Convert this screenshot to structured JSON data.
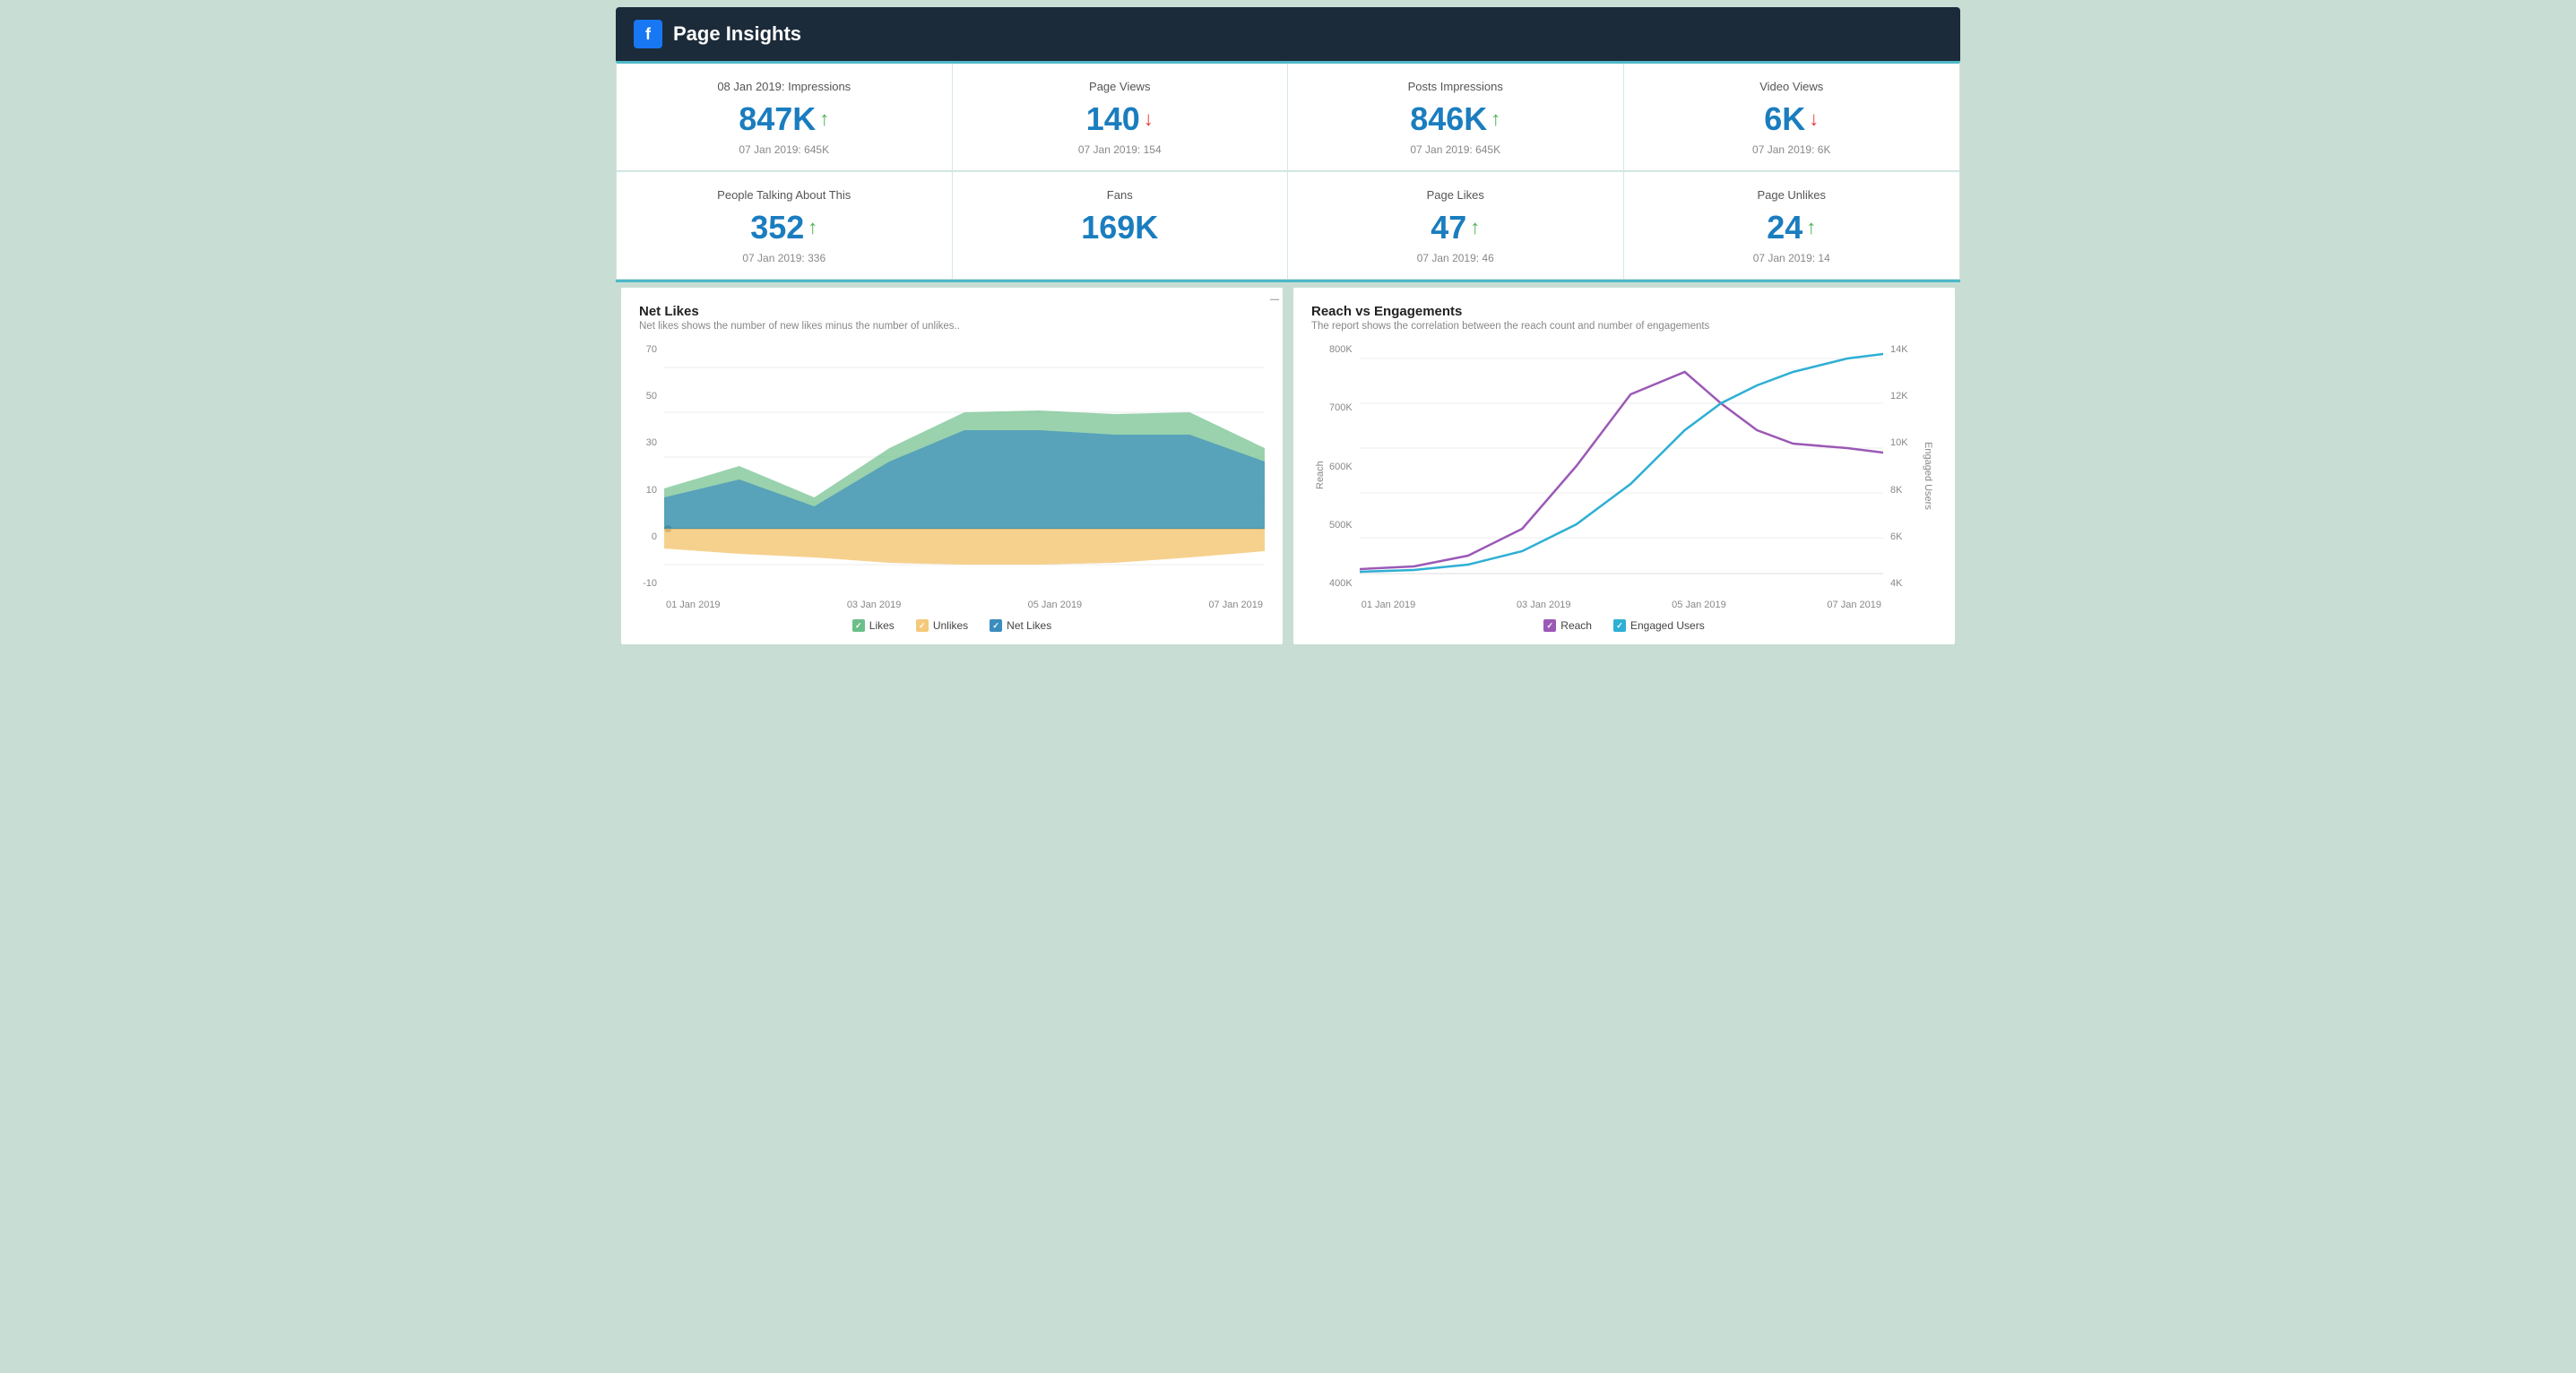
{
  "header": {
    "title": "Page Insights",
    "fb_label": "f"
  },
  "stats_row1": [
    {
      "label": "08 Jan 2019: Impressions",
      "value": "847K",
      "trend": "up",
      "prev": "07 Jan 2019: 645K"
    },
    {
      "label": "Page Views",
      "value": "140",
      "trend": "down",
      "prev": "07 Jan 2019: 154"
    },
    {
      "label": "Posts Impressions",
      "value": "846K",
      "trend": "up",
      "prev": "07 Jan 2019: 645K"
    },
    {
      "label": "Video Views",
      "value": "6K",
      "trend": "down",
      "prev": "07 Jan 2019: 6K"
    }
  ],
  "stats_row2": [
    {
      "label": "People Talking About This",
      "value": "352",
      "trend": "up",
      "prev": "07 Jan 2019: 336"
    },
    {
      "label": "Fans",
      "value": "169K",
      "trend": "none",
      "prev": ""
    },
    {
      "label": "Page Likes",
      "value": "47",
      "trend": "up",
      "prev": "07 Jan 2019: 46"
    },
    {
      "label": "Page Unlikes",
      "value": "24",
      "trend": "up",
      "prev": "07 Jan 2019: 14"
    }
  ],
  "chart_net_likes": {
    "title": "Net Likes",
    "subtitle": "Net likes shows the number of new likes minus the number of unlikes..",
    "y_axis": [
      "70",
      "50",
      "30",
      "10",
      "0",
      "-10"
    ],
    "x_axis": [
      "01 Jan 2019",
      "03 Jan 2019",
      "05 Jan 2019",
      "07 Jan 2019"
    ],
    "legend": [
      {
        "label": "Likes",
        "color": "#6dbf8a"
      },
      {
        "label": "Unlikes",
        "color": "#f5c97a"
      },
      {
        "label": "Net Likes",
        "color": "#3c8dbf"
      }
    ]
  },
  "chart_reach": {
    "title": "Reach vs Engagements",
    "subtitle": "The report shows the correlation between the reach count and number of engagements",
    "y_axis_left": [
      "800K",
      "700K",
      "600K",
      "500K",
      "400K"
    ],
    "y_axis_right": [
      "14K",
      "12K",
      "10K",
      "8K",
      "6K",
      "4K"
    ],
    "y_axis_left_title": "Reach",
    "y_axis_right_title": "Engaged Users",
    "x_axis": [
      "01 Jan 2019",
      "03 Jan 2019",
      "05 Jan 2019",
      "07 Jan 2019"
    ],
    "legend": [
      {
        "label": "Reach",
        "color": "#9b59b6"
      },
      {
        "label": "Engaged Users",
        "color": "#2eafd4"
      }
    ]
  },
  "colors": {
    "accent": "#4db8c8",
    "header_bg": "#1c2b3a",
    "fb_blue": "#1877f2",
    "stat_blue": "#1a7dbf",
    "green": "#4caf50",
    "red": "#e53935"
  }
}
